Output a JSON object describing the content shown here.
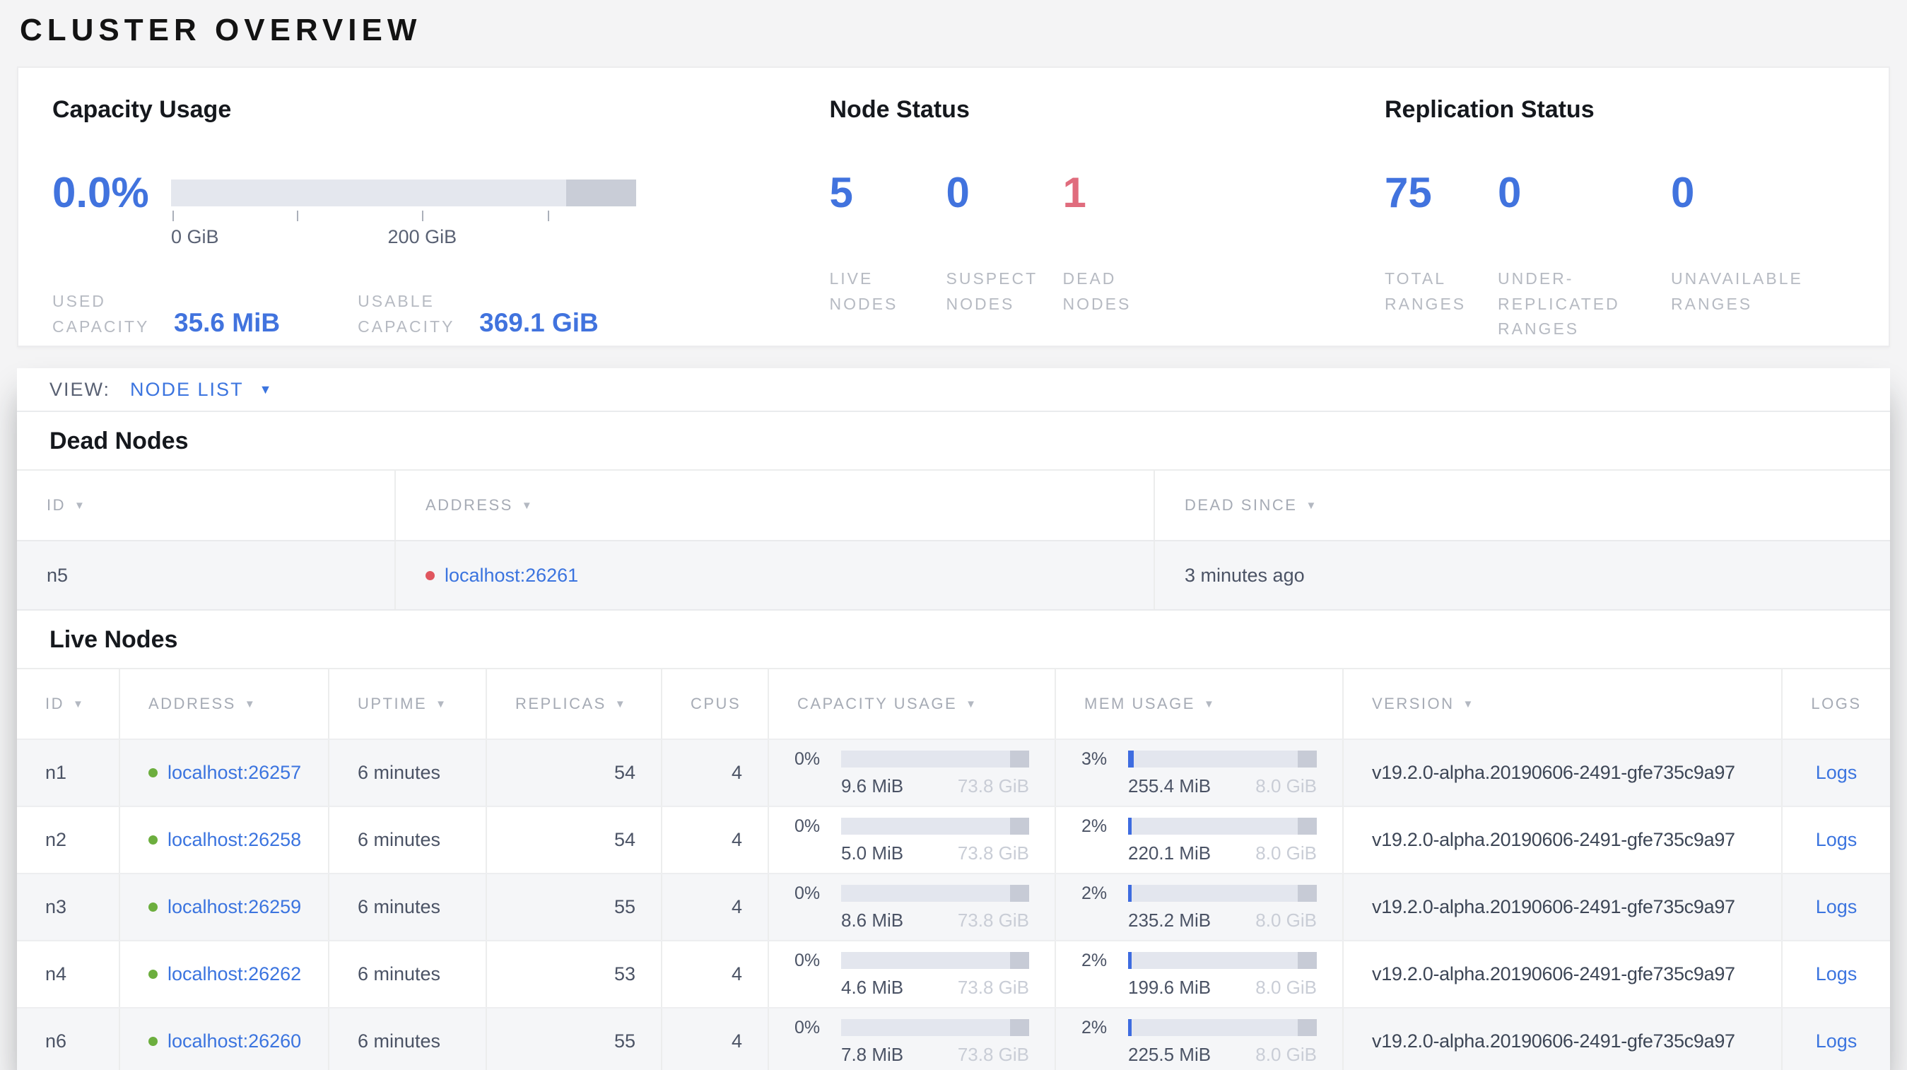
{
  "page": {
    "title": "CLUSTER OVERVIEW"
  },
  "colors": {
    "accent_blue": "#3e74e0",
    "status_red": "#e06c7d",
    "status_green": "#6cae3e",
    "bar_track": "#e4e7ee",
    "bar_other": "#c9cdd7"
  },
  "summary": {
    "capacity": {
      "title": "Capacity Usage",
      "percent": "0.0%",
      "percent_fill": "0",
      "tick_label_0": "0 GiB",
      "tick_label_200": "200 GiB",
      "used_label": "USED CAPACITY",
      "used_value": "35.6 MiB",
      "usable_label": "USABLE CAPACITY",
      "usable_value": "369.1 GiB"
    },
    "node_status": {
      "title": "Node Status",
      "stats": [
        {
          "value": "5",
          "label": "LIVE NODES",
          "color": "blue"
        },
        {
          "value": "0",
          "label": "SUSPECT NODES",
          "color": "blue"
        },
        {
          "value": "1",
          "label": "DEAD NODES",
          "color": "red"
        }
      ]
    },
    "replication": {
      "title": "Replication Status",
      "stats": [
        {
          "value": "75",
          "label": "TOTAL RANGES",
          "color": "blue"
        },
        {
          "value": "0",
          "label": "UNDER-REPLICATED RANGES",
          "color": "blue"
        },
        {
          "value": "0",
          "label": "UNAVAILABLE RANGES",
          "color": "blue"
        }
      ]
    }
  },
  "view_bar": {
    "label": "VIEW:",
    "selected": "NODE LIST"
  },
  "dead_nodes": {
    "title": "Dead Nodes",
    "columns": {
      "id": "ID",
      "address": "ADDRESS",
      "dead_since": "DEAD SINCE"
    },
    "rows": [
      {
        "id": "n5",
        "address": "localhost:26261",
        "dead_since": "3 minutes ago"
      }
    ]
  },
  "live_nodes": {
    "title": "Live Nodes",
    "columns": {
      "id": "ID",
      "address": "ADDRESS",
      "uptime": "UPTIME",
      "replicas": "REPLICAS",
      "cpus": "CPUS",
      "capacity": "CAPACITY USAGE",
      "mem": "MEM USAGE",
      "version": "VERSION",
      "logs": "LOGS"
    },
    "rows": [
      {
        "id": "n1",
        "address": "localhost:26257",
        "uptime": "6 minutes",
        "replicas": "54",
        "cpus": "4",
        "cap_pct": "0%",
        "cap_fill": "0",
        "cap_used": "9.6 MiB",
        "cap_total": "73.8 GiB",
        "mem_pct": "3%",
        "mem_fill": "3",
        "mem_used": "255.4 MiB",
        "mem_total": "8.0 GiB",
        "version": "v19.2.0-alpha.20190606-2491-gfe735c9a97",
        "logs": "Logs"
      },
      {
        "id": "n2",
        "address": "localhost:26258",
        "uptime": "6 minutes",
        "replicas": "54",
        "cpus": "4",
        "cap_pct": "0%",
        "cap_fill": "0",
        "cap_used": "5.0 MiB",
        "cap_total": "73.8 GiB",
        "mem_pct": "2%",
        "mem_fill": "2",
        "mem_used": "220.1 MiB",
        "mem_total": "8.0 GiB",
        "version": "v19.2.0-alpha.20190606-2491-gfe735c9a97",
        "logs": "Logs"
      },
      {
        "id": "n3",
        "address": "localhost:26259",
        "uptime": "6 minutes",
        "replicas": "55",
        "cpus": "4",
        "cap_pct": "0%",
        "cap_fill": "0",
        "cap_used": "8.6 MiB",
        "cap_total": "73.8 GiB",
        "mem_pct": "2%",
        "mem_fill": "2",
        "mem_used": "235.2 MiB",
        "mem_total": "8.0 GiB",
        "version": "v19.2.0-alpha.20190606-2491-gfe735c9a97",
        "logs": "Logs"
      },
      {
        "id": "n4",
        "address": "localhost:26262",
        "uptime": "6 minutes",
        "replicas": "53",
        "cpus": "4",
        "cap_pct": "0%",
        "cap_fill": "0",
        "cap_used": "4.6 MiB",
        "cap_total": "73.8 GiB",
        "mem_pct": "2%",
        "mem_fill": "2",
        "mem_used": "199.6 MiB",
        "mem_total": "8.0 GiB",
        "version": "v19.2.0-alpha.20190606-2491-gfe735c9a97",
        "logs": "Logs"
      },
      {
        "id": "n6",
        "address": "localhost:26260",
        "uptime": "6 minutes",
        "replicas": "55",
        "cpus": "4",
        "cap_pct": "0%",
        "cap_fill": "0",
        "cap_used": "7.8 MiB",
        "cap_total": "73.8 GiB",
        "mem_pct": "2%",
        "mem_fill": "2",
        "mem_used": "225.5 MiB",
        "mem_total": "8.0 GiB",
        "version": "v19.2.0-alpha.20190606-2491-gfe735c9a97",
        "logs": "Logs"
      }
    ]
  }
}
